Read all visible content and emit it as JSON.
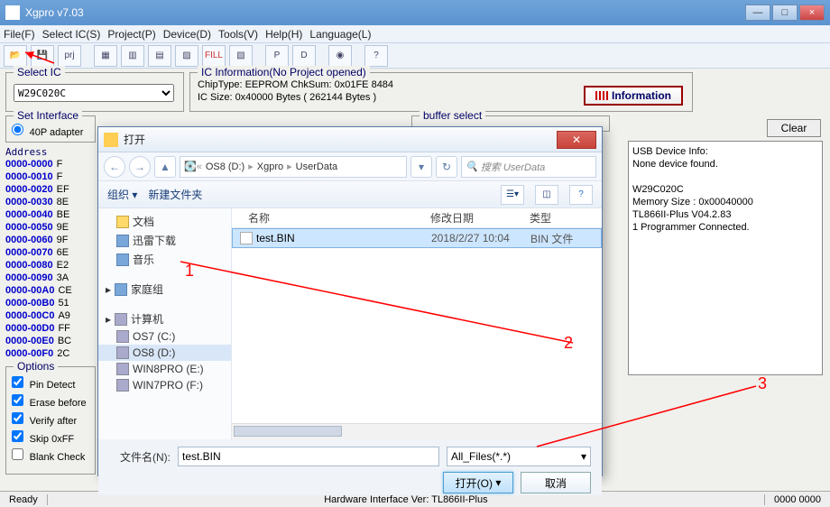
{
  "window": {
    "title": "Xgpro v7.03"
  },
  "menu": [
    "File(F)",
    "Select IC(S)",
    "Project(P)",
    "Device(D)",
    "Tools(V)",
    "Help(H)",
    "Language(L)"
  ],
  "toolbar_icons": [
    "open",
    "save",
    "prj",
    "sep",
    "chip-read",
    "chip-write",
    "chip-verify",
    "chip-blank",
    "fill",
    "chip-erase",
    "sep",
    "dip-p",
    "dip-d",
    "sep",
    "test",
    "sep",
    "help"
  ],
  "select_ic": {
    "title": "Select IC",
    "value": "W29C020C"
  },
  "ic_info": {
    "title": "IC Information(No Project opened)",
    "line1": "ChipType: EEPROM    ChkSum: 0x01FE 8484",
    "line2": "IC Size:   0x40000 Bytes ( 262144 Bytes )",
    "button": "Information"
  },
  "set_interface": {
    "title": "Set Interface",
    "option": "40P adapter"
  },
  "buffer_select": {
    "title": "buffer select"
  },
  "clear": "Clear",
  "hex": {
    "header": "Address",
    "rows": [
      {
        "a": "0000-0000",
        "b": "F"
      },
      {
        "a": "0000-0010",
        "b": "F"
      },
      {
        "a": "0000-0020",
        "b": "EF"
      },
      {
        "a": "0000-0030",
        "b": "8E"
      },
      {
        "a": "0000-0040",
        "b": "BE"
      },
      {
        "a": "0000-0050",
        "b": "9E"
      },
      {
        "a": "0000-0060",
        "b": "9F"
      },
      {
        "a": "0000-0070",
        "b": "6E"
      },
      {
        "a": "0000-0080",
        "b": "E2"
      },
      {
        "a": "0000-0090",
        "b": "3A"
      },
      {
        "a": "0000-00A0",
        "b": "CE"
      },
      {
        "a": "0000-00B0",
        "b": "51"
      },
      {
        "a": "0000-00C0",
        "b": "A9"
      },
      {
        "a": "0000-00D0",
        "b": "FF"
      },
      {
        "a": "0000-00E0",
        "b": "BC"
      },
      {
        "a": "0000-00F0",
        "b": "2C"
      }
    ]
  },
  "right_info": [
    "USB Device Info:",
    "  None device found.",
    "",
    "W29C020C",
    "  Memory Size : 0x00040000",
    "TL866II-Plus V04.2.83",
    "  1  Programmer Connected."
  ],
  "options": {
    "title": "Options",
    "items": [
      "Pin Detect",
      "Erase before",
      "Verify after",
      "Skip 0xFF",
      "Blank Check"
    ]
  },
  "status": {
    "left": "Ready",
    "center": "Hardware Interface Ver: TL866II-Plus",
    "right": "0000 0000"
  },
  "dialog": {
    "title": "打开",
    "path": [
      "OS8 (D:)",
      "Xgpro",
      "UserData"
    ],
    "search_placeholder": "搜索 UserData",
    "toolbar": {
      "organize": "组织 ▾",
      "newfolder": "新建文件夹"
    },
    "tree_docs": "文档",
    "tree_xunlei": "迅雷下载",
    "tree_music": "音乐",
    "tree_homegroup": "家庭组",
    "tree_computer": "计算机",
    "tree_drives": [
      "OS7 (C:)",
      "OS8 (D:)",
      "WIN8PRO (E:)",
      "WIN7PRO (F:)"
    ],
    "columns": {
      "name": "名称",
      "date": "修改日期",
      "type": "类型"
    },
    "file": {
      "name": "test.BIN",
      "date": "2018/2/27 10:04",
      "type": "BIN 文件"
    },
    "filename_label": "文件名(N):",
    "filename_value": "test.BIN",
    "filter": "All_Files(*.*)",
    "open_btn": "打开(O)",
    "cancel_btn": "取消"
  },
  "annotations": {
    "n1": "1",
    "n2": "2",
    "n3": "3"
  }
}
